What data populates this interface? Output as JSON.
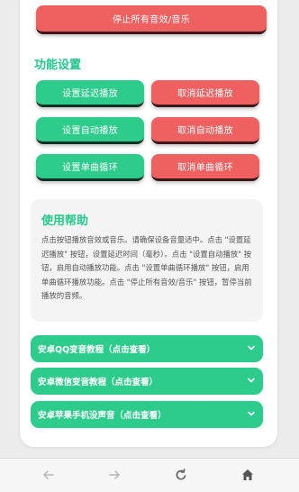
{
  "top": {
    "stop_all_label": "停止所有音效/音乐"
  },
  "settings": {
    "title": "功能设置",
    "rows": [
      {
        "set_label": "设置延迟播放",
        "cancel_label": "取消延迟播放"
      },
      {
        "set_label": "设置自动播放",
        "cancel_label": "取消自动播放"
      },
      {
        "set_label": "设置单曲循环",
        "cancel_label": "取消单曲循环"
      }
    ]
  },
  "help": {
    "title": "使用帮助",
    "text": "点击按钮播放音效或音乐。请确保设备音量适中。点击 \"设置延迟播放\" 按钮，设置延迟时间（毫秒）。点击 \"设置自动播放\" 按钮，启用自动播放功能。点击 \"设置单曲循环播放\" 按钮，启用单曲循环播放功能。点击 \"停止所有音效/音乐\" 按钮，暂停当前播放的音频。"
  },
  "links": [
    {
      "label": "安卓QQ变音教程（点击查看）"
    },
    {
      "label": "安卓微信变音教程（点击查看）"
    },
    {
      "label": "安卓苹果手机没声音（点击查看）"
    }
  ],
  "nav": {
    "icons": [
      "back-arrow-icon",
      "forward-arrow-icon",
      "refresh-icon",
      "home-icon"
    ]
  },
  "colors": {
    "green": "#2ecc8c",
    "red": "#ef6161",
    "title_green": "#23c98a"
  }
}
